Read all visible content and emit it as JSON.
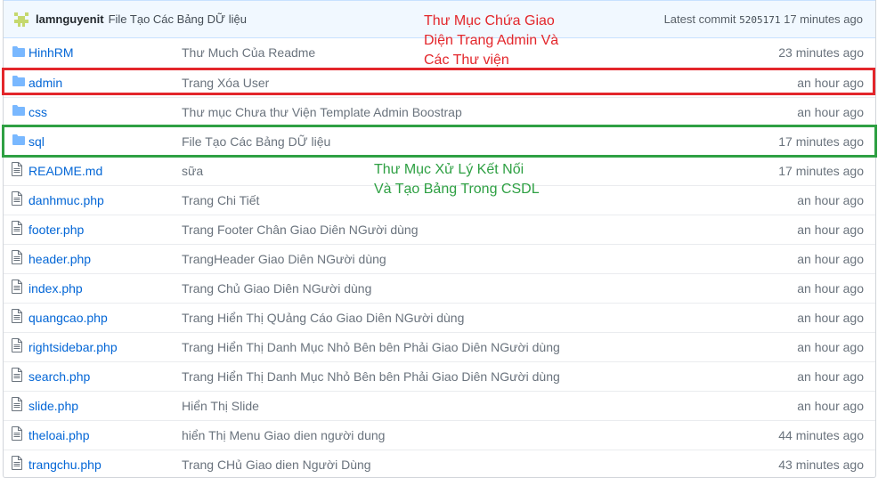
{
  "commit": {
    "author": "lamnguyenit",
    "message": "File Tạo Các Bảng DỮ liệu",
    "latest_label": "Latest commit",
    "sha": "5205171",
    "time": "17 minutes ago"
  },
  "files": [
    {
      "name": "HinhRM",
      "type": "folder",
      "message": "Thư Much Của Readme",
      "age": "23 minutes ago"
    },
    {
      "name": "admin",
      "type": "folder",
      "message": "Trang Xóa User",
      "age": "an hour ago"
    },
    {
      "name": "css",
      "type": "folder",
      "message": "Thư mục Chưa thư Viện Template Admin Boostrap",
      "age": "an hour ago"
    },
    {
      "name": "sql",
      "type": "folder",
      "message": "File Tạo Các Bảng DỮ liệu",
      "age": "17 minutes ago"
    },
    {
      "name": "README.md",
      "type": "file",
      "message": "sữa",
      "age": "17 minutes ago"
    },
    {
      "name": "danhmuc.php",
      "type": "file",
      "message": "Trang Chi Tiết",
      "age": "an hour ago"
    },
    {
      "name": "footer.php",
      "type": "file",
      "message": "Trang Footer Chân Giao Diên NGười dùng",
      "age": "an hour ago"
    },
    {
      "name": "header.php",
      "type": "file",
      "message": "TrangHeader Giao Diên NGười dùng",
      "age": "an hour ago"
    },
    {
      "name": "index.php",
      "type": "file",
      "message": "Trang Chủ Giao Diên NGười dùng",
      "age": "an hour ago"
    },
    {
      "name": "quangcao.php",
      "type": "file",
      "message": "Trang Hiển Thị QUảng Cáo Giao Diên NGười dùng",
      "age": "an hour ago"
    },
    {
      "name": "rightsidebar.php",
      "type": "file",
      "message": "Trang Hiển Thị Danh Mục Nhỏ Bên bên Phải Giao Diên NGười dùng",
      "age": "an hour ago"
    },
    {
      "name": "search.php",
      "type": "file",
      "message": "Trang Hiển Thị Danh Mục Nhỏ Bên bên Phải Giao Diên NGười dùng",
      "age": "an hour ago"
    },
    {
      "name": "slide.php",
      "type": "file",
      "message": "Hiển Thị Slide",
      "age": "an hour ago"
    },
    {
      "name": "theloai.php",
      "type": "file",
      "message": "hiển Thị Menu Giao dien người dung",
      "age": "44 minutes ago"
    },
    {
      "name": "trangchu.php",
      "type": "file",
      "message": "Trang CHủ Giao dien Người Dùng",
      "age": "43 minutes ago"
    }
  ],
  "annotations": {
    "red_note_line1": "Thư Mục Chứa Giao",
    "red_note_line2": "Diện Trang Admin Và",
    "red_note_line3": "Các Thư viện",
    "green_note_line1": "Thư Mục Xử Lý Kết Nối",
    "green_note_line2": "Và Tạo Bảng Trong CSDL",
    "red_color": "#e3262b",
    "green_color": "#2ea043"
  }
}
